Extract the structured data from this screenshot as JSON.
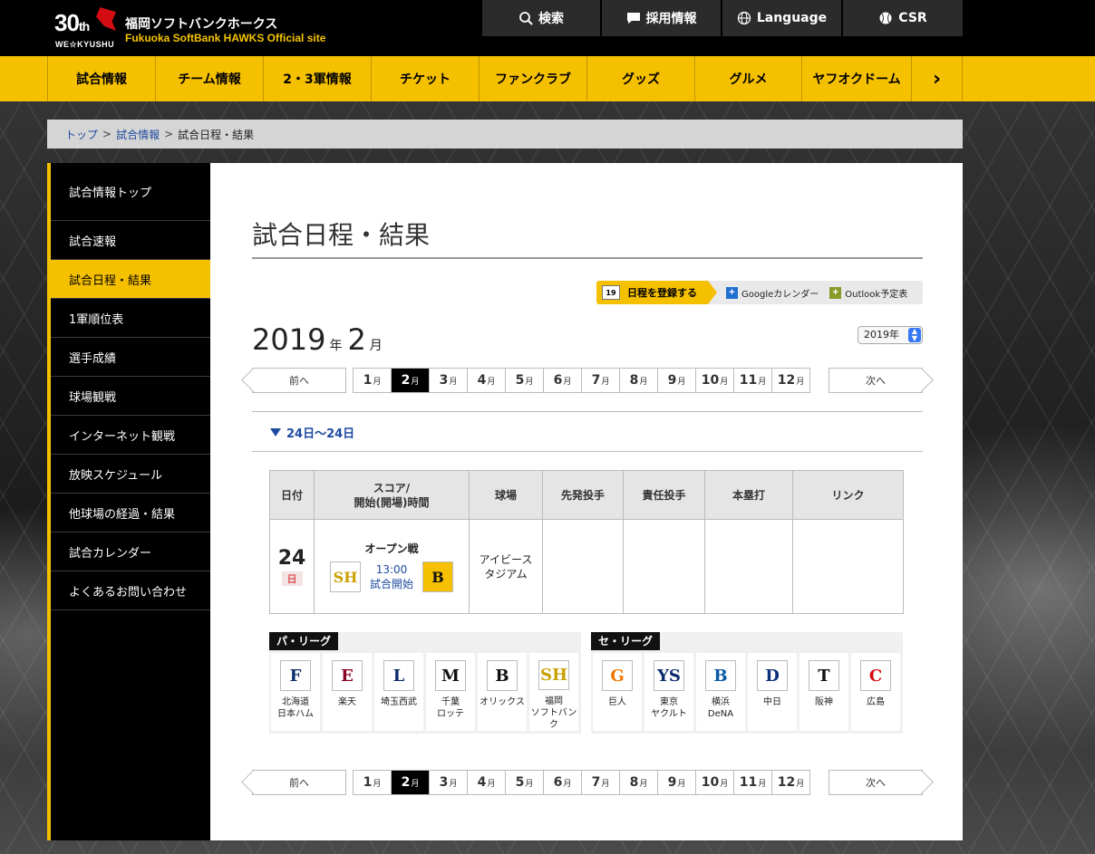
{
  "header": {
    "logo_num": "30",
    "logo_th": "th",
    "logo_sub": "WE☆KYUSHU",
    "site_name": "福岡ソフトバンクホークス",
    "site_sub": "Fukuoka SoftBank HAWKS Official site",
    "utility": [
      {
        "label": "検索",
        "icon": "search-icon"
      },
      {
        "label": "採用情報",
        "icon": "chat-icon"
      },
      {
        "label": "Language",
        "icon": "globe-icon"
      },
      {
        "label": "CSR",
        "icon": "baseball-icon"
      }
    ]
  },
  "nav": {
    "items": [
      "試合情報",
      "チーム情報",
      "2・3軍情報",
      "チケット",
      "ファンクラブ",
      "グッズ",
      "グルメ",
      "ヤフオクドーム"
    ],
    "more": "›"
  },
  "breadcrumb": {
    "items": [
      "トップ",
      "試合情報",
      "試合日程・結果"
    ],
    "sep": ">"
  },
  "sidebar": {
    "items": [
      "試合情報トップ",
      "試合速報",
      "試合日程・結果",
      "1軍順位表",
      "選手成績",
      "球場観戦",
      "インターネット観戦",
      "放映スケジュール",
      "他球場の経過・結果",
      "試合カレンダー",
      "よくあるお問い合わせ"
    ],
    "active_index": 2
  },
  "main": {
    "title": "試合日程・結果",
    "calendar_register": {
      "register": "日程を登録する",
      "google": "Googleカレンダー",
      "outlook": "Outlook予定表",
      "icon_label": "19"
    },
    "year": "2019",
    "year_unit": "年",
    "month": "2",
    "month_unit": "月",
    "year_select": "2019年",
    "month_nav": {
      "prev": "前へ",
      "next": "次へ",
      "months": [
        "1",
        "2",
        "3",
        "4",
        "5",
        "6",
        "7",
        "8",
        "9",
        "10",
        "11",
        "12"
      ],
      "month_suffix": "月",
      "current_index": 1
    },
    "date_range": "24日〜24日",
    "table": {
      "headers": [
        "日付",
        "スコア/\n開始(開場)時間",
        "球場",
        "先発投手",
        "責任投手",
        "本塁打",
        "リンク"
      ],
      "rows": [
        {
          "day": "24",
          "dow": "日",
          "game_type": "オープン戦",
          "home_logo": "SH",
          "away_logo": "B",
          "time": "13:00",
          "status": "試合開始",
          "stadium": "アイビース\nタジアム",
          "starter": "",
          "decision": "",
          "homerun": "",
          "link": ""
        }
      ]
    },
    "pacific": {
      "label": "パ・リーグ",
      "teams": [
        {
          "logo": "F",
          "name": "北海道\n日本ハム",
          "color": "#0a2f6b"
        },
        {
          "logo": "E",
          "name": "楽天",
          "color": "#8c0024"
        },
        {
          "logo": "L",
          "name": "埼玉西武",
          "color": "#0a2a6b"
        },
        {
          "logo": "M",
          "name": "千葉\nロッテ",
          "color": "#111111"
        },
        {
          "logo": "B",
          "name": "オリックス",
          "color": "#111111"
        },
        {
          "logo": "SH",
          "name": "福岡\nソフトバンク",
          "color": "#c9a100"
        }
      ]
    },
    "central": {
      "label": "セ・リーグ",
      "teams": [
        {
          "logo": "G",
          "name": "巨人",
          "color": "#f07800"
        },
        {
          "logo": "YS",
          "name": "東京\nヤクルト",
          "color": "#0a2a6b"
        },
        {
          "logo": "B",
          "name": "横浜\nDeNA",
          "color": "#0a58a8"
        },
        {
          "logo": "D",
          "name": "中日",
          "color": "#0a2f7b"
        },
        {
          "logo": "T",
          "name": "阪神",
          "color": "#111111"
        },
        {
          "logo": "C",
          "name": "広島",
          "color": "#d40d12"
        }
      ]
    }
  }
}
